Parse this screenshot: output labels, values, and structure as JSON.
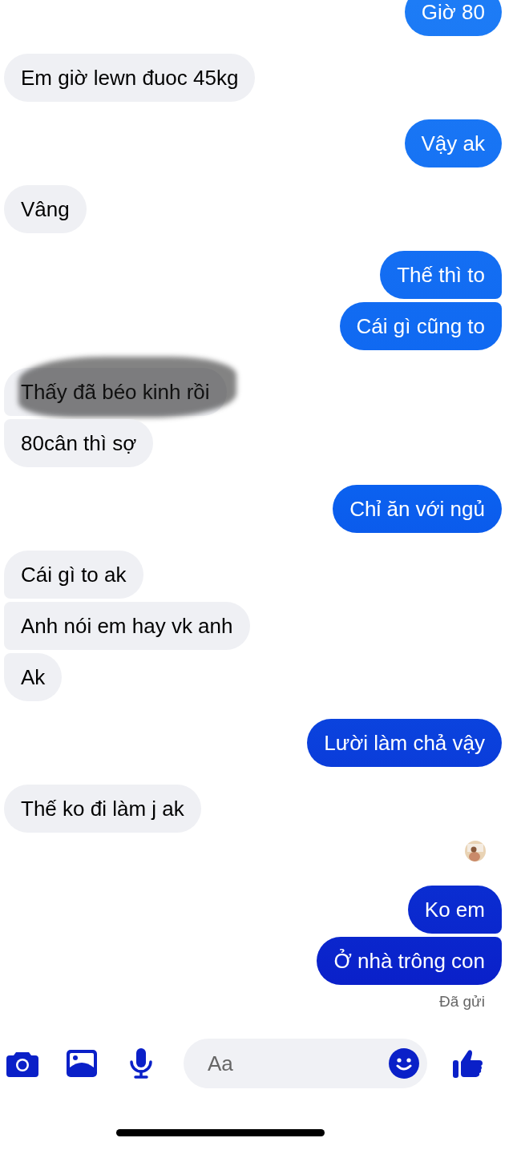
{
  "thread": [
    {
      "kind": "outgoing",
      "messages": [
        {
          "text": "Giờ 80",
          "redacted": false
        }
      ]
    },
    {
      "kind": "incoming",
      "messages": [
        {
          "text": "Em giờ lewn đuoc 45kg",
          "redacted": false
        }
      ]
    },
    {
      "kind": "outgoing",
      "messages": [
        {
          "text": "Vậy ak",
          "redacted": false
        }
      ]
    },
    {
      "kind": "incoming",
      "messages": [
        {
          "text": "Vâng",
          "redacted": false
        }
      ]
    },
    {
      "kind": "outgoing",
      "messages": [
        {
          "text": "Thế thì to",
          "redacted": false
        },
        {
          "text": "Cái gì cũng to",
          "redacted": false
        }
      ]
    },
    {
      "kind": "incoming",
      "messages": [
        {
          "text": "Thấy đã béo kinh rồi",
          "redacted": true
        },
        {
          "text": "80cân thì sợ",
          "redacted": false
        }
      ]
    },
    {
      "kind": "outgoing",
      "messages": [
        {
          "text": "Chỉ ăn với ngủ",
          "redacted": false
        }
      ]
    },
    {
      "kind": "incoming",
      "messages": [
        {
          "text": "Cái gì to ak",
          "redacted": false
        },
        {
          "text": "Anh nói em hay vk anh",
          "redacted": false
        },
        {
          "text": "Ak",
          "redacted": false
        }
      ]
    },
    {
      "kind": "outgoing",
      "messages": [
        {
          "text": "Lười làm chả vậy",
          "redacted": false
        }
      ]
    },
    {
      "kind": "incoming",
      "messages": [
        {
          "text": "Thế ko đi làm j ak",
          "redacted": false
        }
      ]
    },
    {
      "kind": "receipt"
    },
    {
      "kind": "outgoing",
      "messages": [
        {
          "text": "Ko em",
          "redacted": false
        },
        {
          "text": "Ở nhà trông con",
          "redacted": false
        }
      ]
    }
  ],
  "status": "Đã gửi",
  "composer": {
    "placeholder": "Aa"
  }
}
